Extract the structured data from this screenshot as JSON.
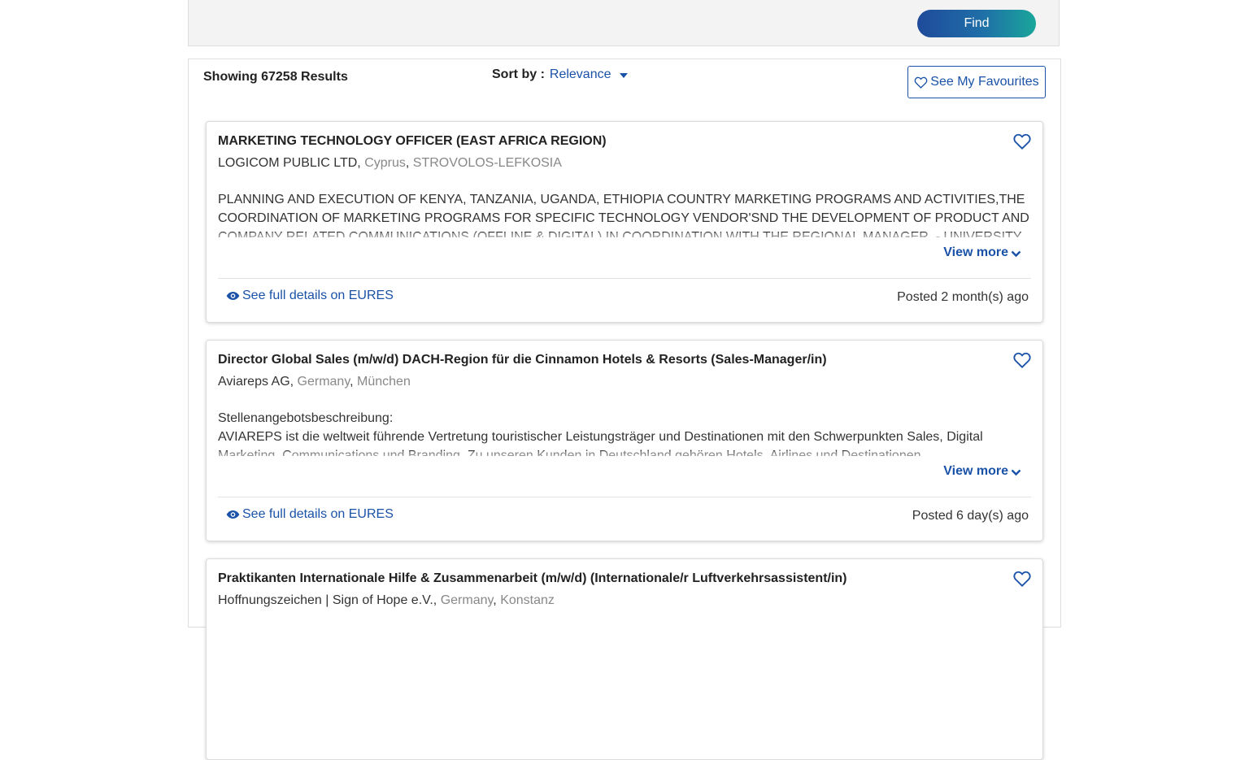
{
  "search": {
    "find_label": "Find"
  },
  "results": {
    "count_label": "Showing 67258 Results",
    "sort_label": "Sort by :",
    "sort_value": "Relevance",
    "favourites_label": "See My Favourites"
  },
  "colors": {
    "accent_blue": "#1a52a8",
    "find_gradient_start": "#1f4a9a",
    "find_gradient_end": "#19a69a"
  },
  "jobs": [
    {
      "title": "MARKETING TECHNOLOGY OFFICER (EAST AFRICA REGION)",
      "company": "LOGICOM PUBLIC LTD",
      "country": "Cyprus",
      "city": "STROVOLOS-LEFKOSIA",
      "description": "PLANNING AND EXECUTION OF KENYA, TANZANIA, UGANDA, ETHIOPIA COUNTRY MARKETING PROGRAMS AND ACTIVITIES,THE COORDINATION OF MARKETING PROGRAMS FOR SPECIFIC TECHNOLOGY VENDOR'SND THE DEVELOPMENT OF PRODUCT AND COMPANY RELATED COMMUNICATIONS (OFFLINE & DIGITAL) IN COORDINATION WITH THE REGIONAL MANAGER. - UNIVERSITY",
      "view_more": "View more",
      "details_link": "See full details on EURES",
      "posted": "Posted 2 month(s) ago"
    },
    {
      "title": "Director Global Sales (m/w/d) DACH-Region für die Cinnamon Hotels & Resorts (Sales-Manager/in)",
      "company": "Aviareps AG",
      "country": "Germany",
      "city": "München",
      "description": "Stellenangebotsbeschreibung:\nAVIAREPS ist die weltweit führende Vertretung touristischer Leistungsträger und Destinationen mit den Schwerpunkten Sales, Digital Marketing, Communications und Branding. Zu unseren Kunden in Deutschland gehören Hotels, Airlines und Destinationen.",
      "view_more": "View more",
      "details_link": "See full details on EURES",
      "posted": "Posted 6 day(s) ago"
    },
    {
      "title": "Praktikanten Internationale Hilfe & Zusammenarbeit (m/w/d) (Internationale/r Luftverkehrsassistent/in)",
      "company": "Hoffnungszeichen | Sign of Hope e.V.",
      "country": "Germany",
      "city": "Konstanz"
    }
  ]
}
